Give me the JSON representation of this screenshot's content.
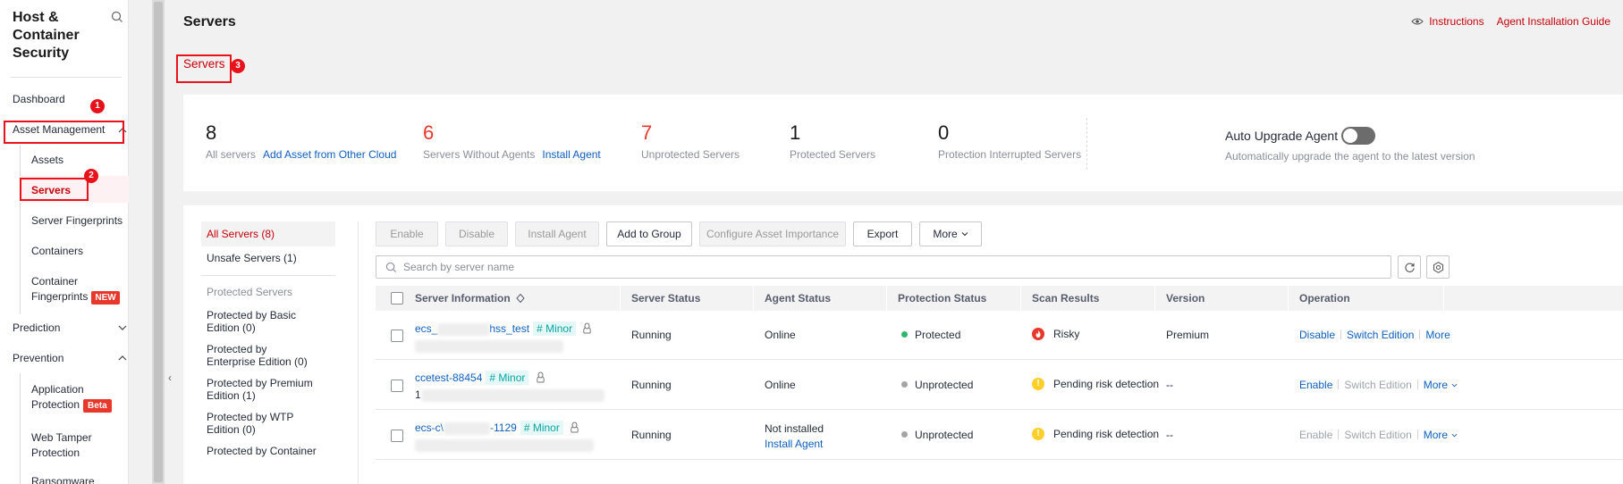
{
  "sidebar": {
    "title": "Host & Container Security",
    "items": {
      "dashboard": "Dashboard",
      "asset_management": "Asset Management",
      "assets": "Assets",
      "servers": "Servers",
      "server_fingerprints": "Server Fingerprints",
      "containers": "Containers",
      "container_fingerprints": "Container Fingerprints",
      "new_tag": "NEW",
      "prediction": "Prediction",
      "prevention": "Prevention",
      "application_protection": "Application Protection",
      "beta_tag": "Beta",
      "web_tamper_protection": "Web Tamper Protection",
      "ransomware": "Ransomware"
    }
  },
  "annotations": {
    "badge1": "1",
    "badge2": "2",
    "badge3": "3"
  },
  "header": {
    "title": "Servers",
    "instructions": "Instructions",
    "agent_guide": "Agent Installation Guide"
  },
  "tabs": {
    "servers": "Servers"
  },
  "summary": {
    "all_servers": {
      "count": "8",
      "label": "All servers",
      "link": "Add Asset from Other Cloud"
    },
    "without_agents": {
      "count": "6",
      "label": "Servers Without Agents",
      "link": "Install Agent"
    },
    "unprotected": {
      "count": "7",
      "label": "Unprotected Servers"
    },
    "protected": {
      "count": "1",
      "label": "Protected Servers"
    },
    "interrupted": {
      "count": "0",
      "label": "Protection Interrupted Servers"
    },
    "auto_upgrade": {
      "title": "Auto Upgrade Agent",
      "enabled": false,
      "desc": "Automatically upgrade the agent to the latest version"
    }
  },
  "filters": {
    "all": "All Servers (8)",
    "unsafe": "Unsafe Servers (1)",
    "protected_group": "Protected Servers",
    "basic": "Protected by Basic Edition (0)",
    "enterprise": "Protected by Enterprise Edition (0)",
    "premium": "Protected by Premium Edition (1)",
    "wtp": "Protected by WTP Edition (0)",
    "container": "Protected by Container"
  },
  "toolbar": {
    "enable": "Enable",
    "disable": "Disable",
    "install_agent": "Install Agent",
    "add_to_group": "Add to Group",
    "configure_importance": "Configure Asset Importance",
    "export": "Export",
    "more": "More"
  },
  "search": {
    "placeholder": "Search by server name"
  },
  "table": {
    "headers": {
      "server_info": "Server Information",
      "server_status": "Server Status",
      "agent_status": "Agent Status",
      "protection_status": "Protection Status",
      "scan_results": "Scan Results",
      "version": "Version",
      "operation": "Operation"
    },
    "rows": [
      {
        "name_prefix": "ecs_",
        "name_suffix": "hss_test",
        "tag": "# Minor",
        "server_status": "Running",
        "agent_status": "Online",
        "protection_status": "Protected",
        "protection_color": "#2fb76e",
        "scan_result": "Risky",
        "scan_color": "#e8372b",
        "version": "Premium",
        "op1": "Disable",
        "op2": "Switch Edition",
        "op3": "More"
      },
      {
        "name_prefix": "ccetest-88454",
        "name_suffix": "",
        "tag": "# Minor",
        "ip_prefix": "1",
        "server_status": "Running",
        "agent_status": "Online",
        "protection_status": "Unprotected",
        "protection_color": "#a5a5a5",
        "scan_result": "Pending risk detection",
        "scan_color": "#ffcf29",
        "version": "--",
        "op1": "Enable",
        "op2": "Switch Edition",
        "op3": "More"
      },
      {
        "name_prefix": "ecs-c\\",
        "name_suffix": "-1129",
        "tag": "# Minor",
        "server_status": "Running",
        "agent_status": "Not installed",
        "agent_link": "Install Agent",
        "protection_status": "Unprotected",
        "protection_color": "#a5a5a5",
        "scan_result": "Pending risk detection",
        "scan_color": "#ffcf29",
        "version": "--",
        "op1": "Enable",
        "op2": "Switch Edition",
        "op3": "More"
      }
    ]
  }
}
